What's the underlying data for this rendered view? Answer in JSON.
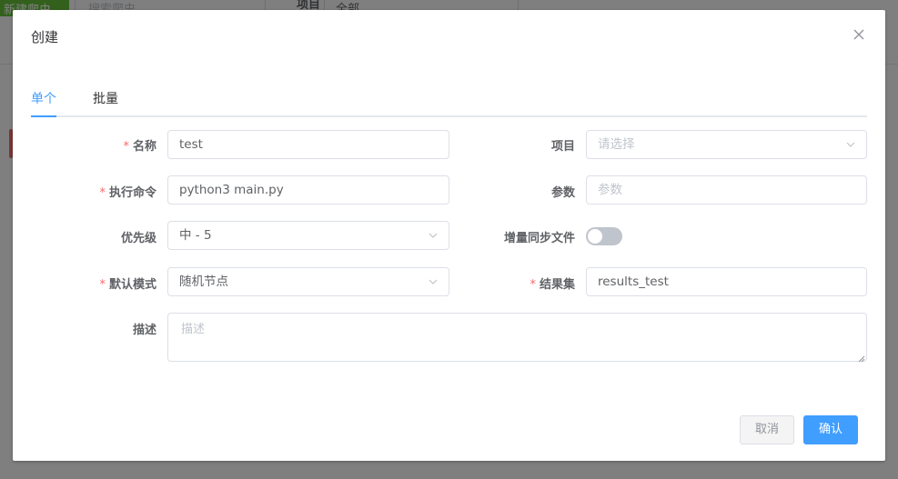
{
  "background": {
    "new_button_label": "新建爬虫",
    "search_placeholder": "搜索爬虫",
    "project_label": "项目",
    "project_value": "全部"
  },
  "dialog": {
    "title": "创建",
    "close_icon": "close-icon",
    "tabs": [
      {
        "label": "单个",
        "active": true
      },
      {
        "label": "批量",
        "active": false
      }
    ],
    "fields": {
      "name": {
        "label": "名称",
        "required": true,
        "value": "test"
      },
      "command": {
        "label": "执行命令",
        "required": true,
        "value": "python3 main.py"
      },
      "priority": {
        "label": "优先级",
        "required": false,
        "value": "中 - 5"
      },
      "mode": {
        "label": "默认模式",
        "required": true,
        "value": "随机节点"
      },
      "description": {
        "label": "描述",
        "required": false,
        "placeholder": "描述"
      },
      "project": {
        "label": "项目",
        "required": false,
        "placeholder": "请选择"
      },
      "params": {
        "label": "参数",
        "required": false,
        "placeholder": "参数"
      },
      "incremental_sync": {
        "label": "增量同步文件",
        "required": false,
        "enabled": false
      },
      "result_collection": {
        "label": "结果集",
        "required": true,
        "value": "results_test"
      }
    },
    "required_mark": "*",
    "cancel_label": "取消",
    "confirm_label": "确认"
  },
  "colors": {
    "primary": "#409eff",
    "required": "#f56c6c",
    "success": "#67c23a"
  }
}
